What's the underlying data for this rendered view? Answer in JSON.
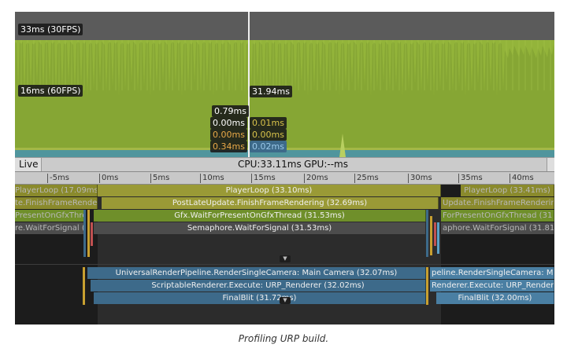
{
  "chart": {
    "label_33ms": "33ms (30FPS)",
    "label_16ms": "16ms (60FPS)",
    "cursor_value": "31.94ms",
    "stats_left": [
      "0.79ms",
      "0.00ms",
      "0.00ms",
      "0.34ms"
    ],
    "stats_right": [
      "0.01ms",
      "0.00ms",
      "0.02ms"
    ],
    "colors": {
      "frame_bar": "#93b43a",
      "bg": "#5b5b5b",
      "gpu": "#3d8fc0"
    }
  },
  "toolbar": {
    "live_label": "Live",
    "cpu_label": "CPU:33.11ms",
    "gpu_label": "GPU:--ms"
  },
  "ruler": {
    "ticks": [
      "-5ms",
      "0ms",
      "5ms",
      "10ms",
      "15ms",
      "20ms",
      "25ms",
      "30ms",
      "35ms",
      "40ms"
    ]
  },
  "tracks": {
    "main": {
      "playerloop_prev": "PlayerLoop (17.09ms)",
      "playerloop": "PlayerLoop (33.10ms)",
      "playerloop_next": "PlayerLoop (33.41ms)",
      "postlate_prev": "te.FinishFrameRende",
      "postlate": "PostLateUpdate.FinishFrameRendering (32.69ms)",
      "postlate_next": "Update.FinishFrameRendering",
      "gfx_prev": "PresentOnGfxThre",
      "gfx": "Gfx.WaitForPresentOnGfxThread (31.53ms)",
      "gfx_next": "ForPresentOnGfxThread (31",
      "sem_prev": "re.WaitForSignal (",
      "sem": "Semaphore.WaitForSignal (31.53ms)",
      "sem_next": "aphore.WaitForSignal (31.81"
    },
    "render": {
      "urp": "UniversalRenderPipeline.RenderSingleCamera: Main Camera (32.07ms)",
      "urp_next": "peline.RenderSingleCamera: Main",
      "sr": "ScriptableRenderer.Execute: URP_Renderer (32.02ms)",
      "sr_next": "Renderer.Execute: URP_Renderer",
      "fb": "FinalBlit (31.72ms)",
      "fb_next": "FinalBlit (32.00ms)"
    }
  },
  "caption": "Profiling URP build."
}
